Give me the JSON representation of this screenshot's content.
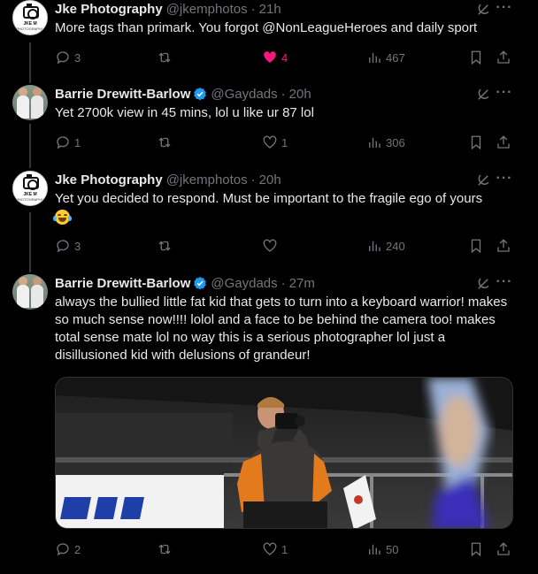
{
  "tweets": [
    {
      "name": "Jke Photography",
      "handle": "@jkemphotos",
      "time": "21h",
      "text": "More tags than primark. You forgot @NonLeagueHeroes and daily sport",
      "replies": "3",
      "likes": "4",
      "views": "467",
      "liked": true,
      "avatar_text": "JKE M",
      "avatar_sub": "PHOTOGRAPHY"
    },
    {
      "name": "Barrie Drewitt-Barlow",
      "handle": "@Gaydads",
      "time": "20h",
      "text": "Yet 2700k view in 45 mins, lol u like ur 87 lol",
      "replies": "1",
      "likes": "1",
      "views": "306",
      "verified": true
    },
    {
      "name": "Jke Photography",
      "handle": "@jkemphotos",
      "time": "20h",
      "text": "Yet you decided to respond. Must be important to the fragile ego of yours",
      "emoji": "face-with-tears-of-joy",
      "replies": "3",
      "likes": "",
      "views": "240",
      "avatar_text": "JKE M",
      "avatar_sub": "PHOTOGRAPHY"
    },
    {
      "name": "Barrie Drewitt-Barlow",
      "handle": "@Gaydads",
      "time": "27m",
      "text": "always the bullied little fat kid that gets to turn into a keyboard warrior! makes so much sense now!!!! lolol and a face to be behind the camera too! makes total sense mate lol no way this is a serious photographer lol just a disillusioned kid with delusions of grandeur!",
      "replies": "2",
      "likes": "1",
      "views": "50",
      "verified": true,
      "media": "photographer-at-football-match-photo"
    }
  ],
  "separator": "·",
  "colors": {
    "background": "#000000",
    "text": "#e7e9ea",
    "muted": "#71767b",
    "verified": "#1d9bf0",
    "like": "#f91880",
    "thread_line": "#333639"
  }
}
